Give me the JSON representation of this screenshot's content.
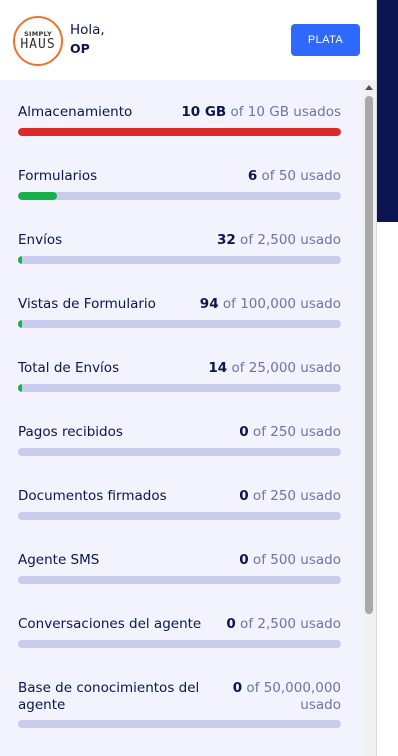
{
  "header": {
    "logo": {
      "top": "SIMPLY",
      "bottom": "HAUS"
    },
    "greeting": "Hola,",
    "username": "OP",
    "plan_button": "PLATA"
  },
  "colors": {
    "accent": "#2e69ff",
    "navy": "#0a1551",
    "track": "#c8cbec",
    "green": "#18b04a",
    "red": "#dc2a2a",
    "logo_ring": "#e8762d"
  },
  "usage": [
    {
      "label": "Almacenamiento",
      "used": "10 GB",
      "rest": " of 10 GB usados",
      "percent": 100,
      "color": "#dc2a2a"
    },
    {
      "label": "Formularios",
      "used": "6",
      "rest": " of 50 usado",
      "percent": 12,
      "color": "#18b04a"
    },
    {
      "label": "Envíos",
      "used": "32",
      "rest": " of 2,500 usado",
      "percent": 1.28,
      "color": "#18b04a"
    },
    {
      "label": "Vistas de Formulario",
      "used": "94",
      "rest": " of 100,000 usado",
      "percent": 0.094,
      "color": "#18b04a"
    },
    {
      "label": "Total de Envíos",
      "used": "14",
      "rest": " of 25,000 usado",
      "percent": 0.056,
      "color": "#18b04a"
    },
    {
      "label": "Pagos recibidos",
      "used": "0",
      "rest": " of 250 usado",
      "percent": 0,
      "color": "#18b04a"
    },
    {
      "label": "Documentos firmados",
      "used": "0",
      "rest": " of 250 usado",
      "percent": 0,
      "color": "#18b04a"
    },
    {
      "label": "Agente SMS",
      "used": "0",
      "rest": " of 500 usado",
      "percent": 0,
      "color": "#18b04a"
    },
    {
      "label": "Conversaciones del agente",
      "used": "0",
      "rest": " of 2,500 usado",
      "percent": 0,
      "color": "#18b04a"
    },
    {
      "label": "Base de conocimientos del agente",
      "used": "0",
      "rest": " of 50,000,000 usado",
      "percent": 0,
      "color": "#18b04a"
    }
  ]
}
